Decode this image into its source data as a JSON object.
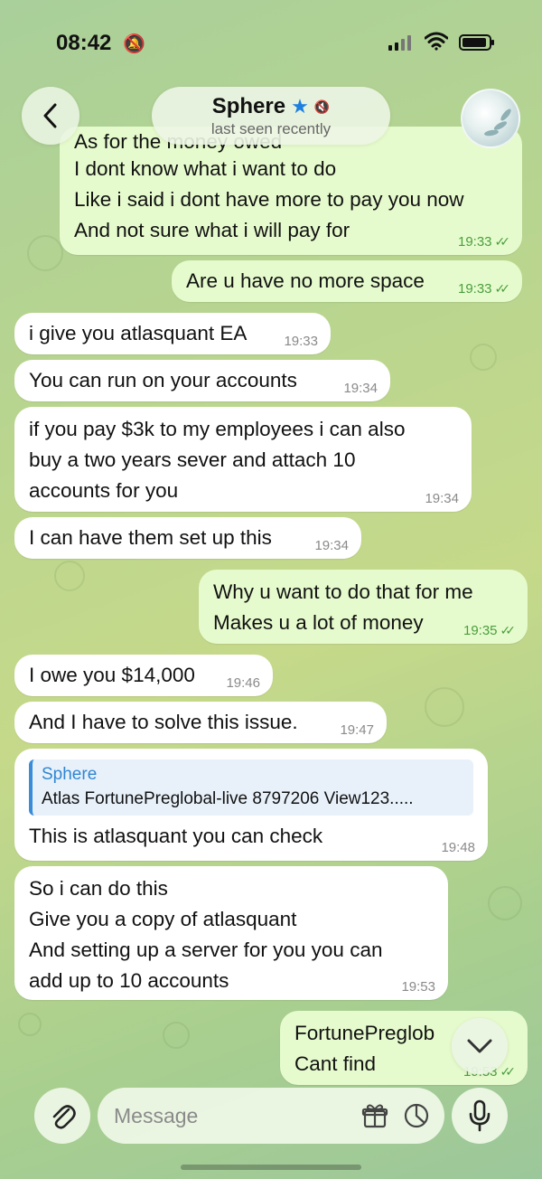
{
  "status_bar": {
    "time": "08:42"
  },
  "header": {
    "contact_name": "Sphere",
    "last_seen": "last seen recently"
  },
  "messages": [
    {
      "dir": "out",
      "lines": [
        "As for the money owed",
        "I dont know what i want to do",
        "Like i said i dont have more to pay you now",
        "And not sure what i will pay for"
      ],
      "time": "19:33"
    },
    {
      "dir": "out",
      "lines": [
        "Are u have no more space"
      ],
      "time": "19:33"
    },
    {
      "dir": "in",
      "lines": [
        "i give you atlasquant EA"
      ],
      "time": "19:33"
    },
    {
      "dir": "in",
      "lines": [
        "You can run on your accounts"
      ],
      "time": "19:34"
    },
    {
      "dir": "in",
      "lines": [
        "if you pay $3k to my employees i can also",
        "buy a two years sever and attach 10",
        "accounts for you"
      ],
      "time": "19:34"
    },
    {
      "dir": "in",
      "lines": [
        "I can have them set up this"
      ],
      "time": "19:34"
    },
    {
      "dir": "out",
      "lines": [
        "Why u want to do that for me",
        "Makes u a lot of money"
      ],
      "time": "19:35"
    },
    {
      "dir": "in",
      "lines": [
        "I owe you $14,000"
      ],
      "time": "19:46"
    },
    {
      "dir": "in",
      "lines": [
        "And I have to solve this issue."
      ],
      "time": "19:47"
    },
    {
      "dir": "in",
      "reply_to": {
        "name": "Sphere",
        "text": "Atlas FortunePreglobal-live 8797206 View123....."
      },
      "lines": [
        "This is atlasquant you can check"
      ],
      "time": "19:48"
    },
    {
      "dir": "in",
      "lines": [
        "So i can do this",
        "Give you a copy of atlasquant",
        "And setting up a server for you you can",
        "add up to 10 accounts"
      ],
      "time": "19:53"
    },
    {
      "dir": "out",
      "lines": [
        "FortunePreglob",
        "Cant find"
      ],
      "time": "19:53"
    }
  ],
  "composer": {
    "placeholder": "Message"
  }
}
